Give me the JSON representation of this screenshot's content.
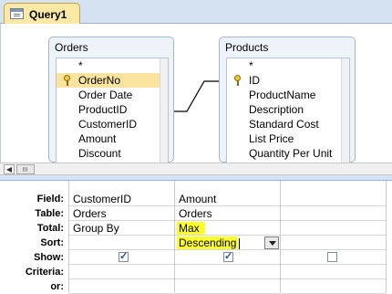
{
  "tab": {
    "label": "Query1"
  },
  "tables": [
    {
      "name": "Orders",
      "fields": [
        "*",
        "OrderNo",
        "Order Date",
        "ProductID",
        "CustomerID",
        "Amount",
        "Discount"
      ]
    },
    {
      "name": "Products",
      "fields": [
        "*",
        "ID",
        "ProductName",
        "Description",
        "Standard Cost",
        "List Price",
        "Quantity Per Unit"
      ]
    }
  ],
  "grid": {
    "row_labels": [
      "Field:",
      "Table:",
      "Total:",
      "Sort:",
      "Show:",
      "Criteria:",
      "or:"
    ],
    "columns": [
      {
        "field": "CustomerID",
        "table": "Orders",
        "total": "Group By",
        "sort": "",
        "show": true
      },
      {
        "field": "Amount",
        "table": "Orders",
        "total": "Max",
        "sort": "Descending",
        "show": true
      },
      {
        "field": "",
        "table": "",
        "total": "",
        "sort": "",
        "show": false
      }
    ]
  },
  "colors": {
    "highlight": "#ffff2a",
    "selected_field": "#fbe4a0",
    "tab": "#fbe9a5"
  }
}
